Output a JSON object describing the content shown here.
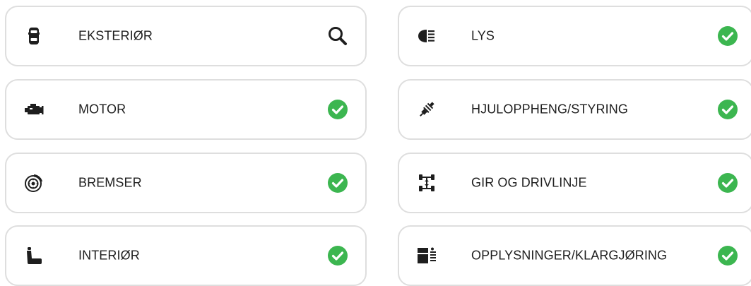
{
  "colors": {
    "card_border": "#dedede",
    "check_green": "#3cb650",
    "icon_dark": "#1e1e1e"
  },
  "categories": [
    {
      "label": "EKSTERIØR",
      "icon": "car-top-icon",
      "status": "inspect",
      "status_icon": "magnifier-icon"
    },
    {
      "label": "LYS",
      "icon": "headlight-icon",
      "status": "ok",
      "status_icon": "check-circle-icon"
    },
    {
      "label": "MOTOR",
      "icon": "engine-icon",
      "status": "ok",
      "status_icon": "check-circle-icon"
    },
    {
      "label": "HJULOPPHENG/STYRING",
      "icon": "shock-absorber-icon",
      "status": "ok",
      "status_icon": "check-circle-icon"
    },
    {
      "label": "BREMSER",
      "icon": "brake-disc-icon",
      "status": "ok",
      "status_icon": "check-circle-icon"
    },
    {
      "label": "GIR OG DRIVLINJE",
      "icon": "drivetrain-icon",
      "status": "ok",
      "status_icon": "check-circle-icon"
    },
    {
      "label": "INTERIØR",
      "icon": "car-seat-icon",
      "status": "ok",
      "status_icon": "check-circle-icon"
    },
    {
      "label": "OPPLYSNINGER/KLARGJØRING",
      "icon": "info-document-icon",
      "status": "ok",
      "status_icon": "check-circle-icon"
    }
  ]
}
